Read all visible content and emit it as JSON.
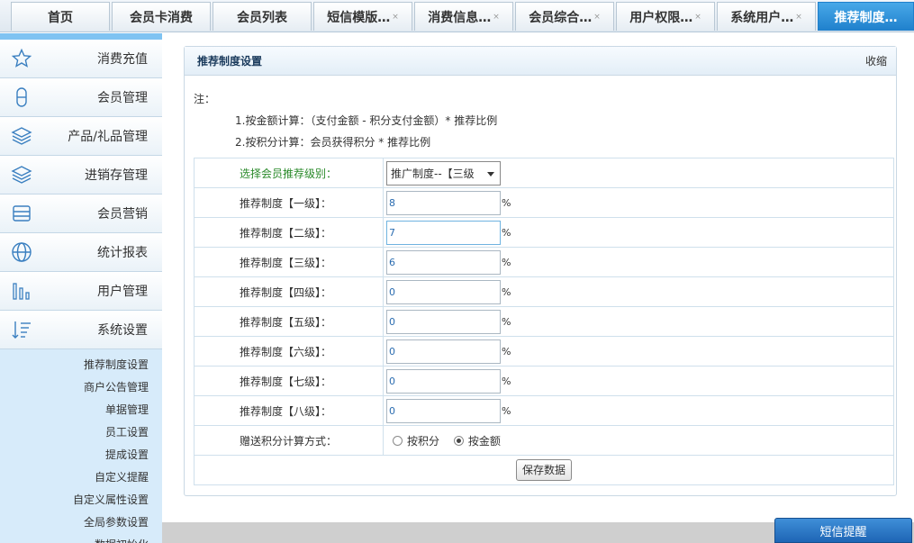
{
  "tabs": [
    {
      "label": "首页",
      "closable": false,
      "active": false
    },
    {
      "label": "会员卡消费",
      "closable": false,
      "active": false
    },
    {
      "label": "会员列表",
      "closable": false,
      "active": false
    },
    {
      "label": "短信模版…",
      "closable": true,
      "active": false
    },
    {
      "label": "消费信息…",
      "closable": true,
      "active": false
    },
    {
      "label": "会员综合…",
      "closable": true,
      "active": false
    },
    {
      "label": "用户权限…",
      "closable": true,
      "active": false
    },
    {
      "label": "系统用户…",
      "closable": true,
      "active": false
    },
    {
      "label": "推荐制度…",
      "closable": false,
      "active": true
    }
  ],
  "close_glyph": "×",
  "sidebar": {
    "items": [
      {
        "label": "消费充值",
        "icon": "star-icon"
      },
      {
        "label": "会员管理",
        "icon": "user-icon"
      },
      {
        "label": "产品/礼品管理",
        "icon": "layers-icon"
      },
      {
        "label": "进销存管理",
        "icon": "layers-icon"
      },
      {
        "label": "会员营销",
        "icon": "inbox-icon"
      },
      {
        "label": "统计报表",
        "icon": "globe-icon"
      },
      {
        "label": "用户管理",
        "icon": "bar-chart-icon"
      },
      {
        "label": "系统设置",
        "icon": "sort-list-icon"
      }
    ],
    "subitems": [
      "推荐制度设置",
      "商户公告管理",
      "单据管理",
      "员工设置",
      "提成设置",
      "自定义提醒",
      "自定义属性设置",
      "全局参数设置",
      "数据初始化"
    ]
  },
  "panel": {
    "title": "推荐制度设置",
    "collapse_label": "收缩",
    "note_title": "注：",
    "notes": [
      "1.按金额计算：（支付金额 - 积分支付金额）* 推荐比例",
      "2.按积分计算：会员获得积分 * 推荐比例"
    ]
  },
  "form": {
    "level_label": "选择会员推荐级别：",
    "level_selected": "推广制度--【三级",
    "percent_sign": "%",
    "levels": [
      {
        "label": "推荐制度【一级】：",
        "value": "8"
      },
      {
        "label": "推荐制度【二级】：",
        "value": "7"
      },
      {
        "label": "推荐制度【三级】：",
        "value": "6"
      },
      {
        "label": "推荐制度【四级】：",
        "value": "0"
      },
      {
        "label": "推荐制度【五级】：",
        "value": "0"
      },
      {
        "label": "推荐制度【六级】：",
        "value": "0"
      },
      {
        "label": "推荐制度【七级】：",
        "value": "0"
      },
      {
        "label": "推荐制度【八级】：",
        "value": "0"
      }
    ],
    "calc_label": "赠送积分计算方式：",
    "calc_options": [
      {
        "label": "按积分",
        "checked": false
      },
      {
        "label": "按金额",
        "checked": true
      }
    ],
    "save_label": "保存数据"
  },
  "sms_reminder_label": "短信提醒",
  "colors": {
    "active_tab": "#2a8ad8",
    "sidebar_bg": "#d7ebfa",
    "accent_label": "#2a8a2a"
  }
}
